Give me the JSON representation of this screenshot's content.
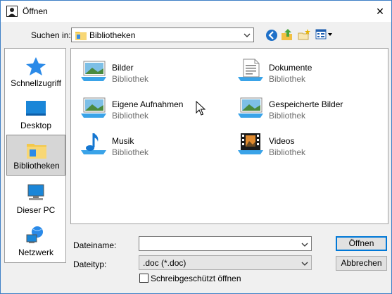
{
  "window": {
    "title": "Öffnen"
  },
  "lookin": {
    "label": "Suchen in:",
    "value": "Bibliotheken"
  },
  "toolbar": [
    "back-icon",
    "up-folder-icon",
    "new-folder-icon",
    "view-menu-icon"
  ],
  "places": [
    {
      "label": "Schnellzugriff",
      "icon": "star-icon"
    },
    {
      "label": "Desktop",
      "icon": "desktop-icon"
    },
    {
      "label": "Bibliotheken",
      "icon": "libraries-icon",
      "selected": true
    },
    {
      "label": "Dieser PC",
      "icon": "computer-icon"
    },
    {
      "label": "Netzwerk",
      "icon": "network-icon"
    }
  ],
  "items": [
    {
      "name": "Bilder",
      "sub": "Bibliothek",
      "icon": "pictures-library-icon"
    },
    {
      "name": "Dokumente",
      "sub": "Bibliothek",
      "icon": "documents-library-icon"
    },
    {
      "name": "Eigene Aufnahmen",
      "sub": "Bibliothek",
      "icon": "camera-roll-library-icon"
    },
    {
      "name": "Gespeicherte Bilder",
      "sub": "Bibliothek",
      "icon": "saved-pictures-library-icon"
    },
    {
      "name": "Musik",
      "sub": "Bibliothek",
      "icon": "music-library-icon"
    },
    {
      "name": "Videos",
      "sub": "Bibliothek",
      "icon": "videos-library-icon"
    }
  ],
  "filename": {
    "label": "Dateiname:",
    "value": ""
  },
  "filetype": {
    "label": "Dateityp:",
    "value": ".doc (*.doc)"
  },
  "readonly": {
    "label": "Schreibgeschützt öffnen",
    "checked": false
  },
  "buttons": {
    "open": "Öffnen",
    "cancel": "Abbrechen"
  }
}
